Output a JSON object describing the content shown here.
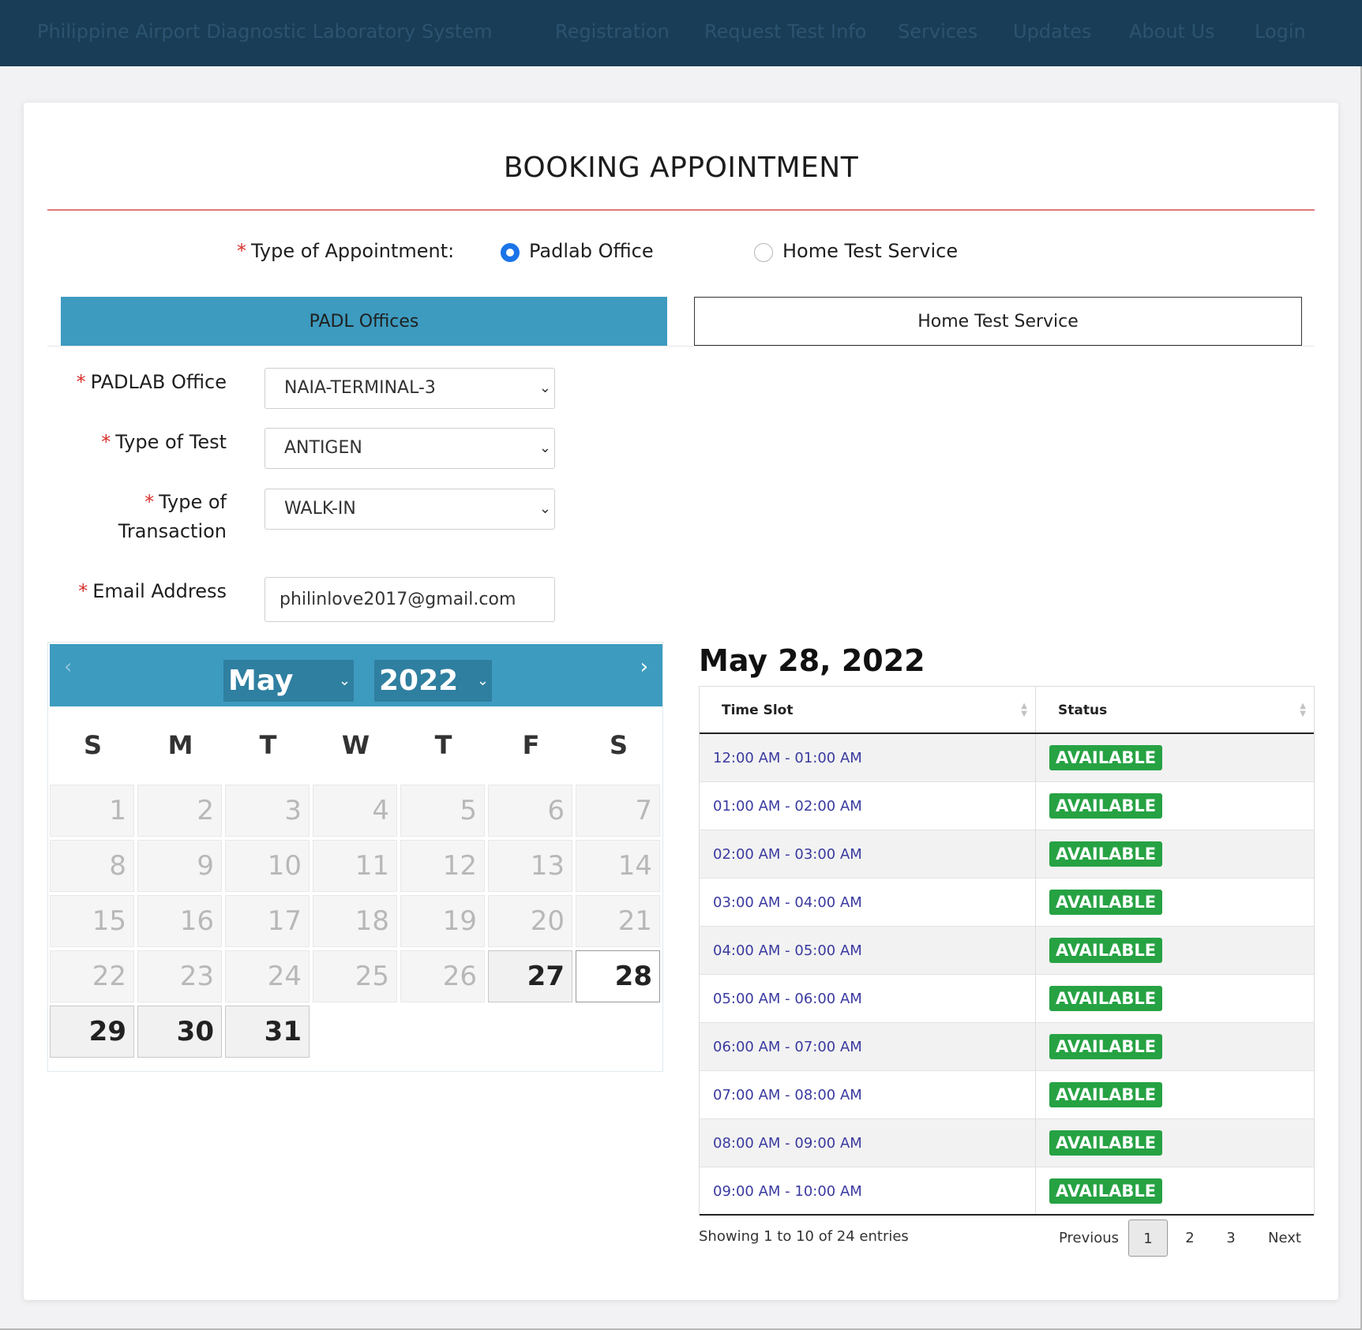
{
  "nav": {
    "brand": "Philippine Airport Diagnostic Laboratory System",
    "links": [
      "Registration",
      "Request Test Info",
      "Services",
      "Updates",
      "About Us",
      "Login"
    ]
  },
  "page_title": "BOOKING APPOINTMENT",
  "appointment": {
    "label": "Type of Appointment:",
    "options": [
      "Padlab Office",
      "Home Test Service"
    ],
    "selected": "Padlab Office"
  },
  "tabs": [
    "PADL Offices",
    "Home Test Service"
  ],
  "form": {
    "office_label": "PADLAB Office",
    "office_value": "NAIA-TERMINAL-3",
    "test_label": "Type of Test",
    "test_value": "ANTIGEN",
    "transaction_label_1": "Type of",
    "transaction_label_2": "Transaction",
    "transaction_value": "WALK-IN",
    "email_label": "Email Address",
    "email_value": "philinlove2017@gmail.com"
  },
  "calendar": {
    "month": "May",
    "year": "2022",
    "weekdays": [
      "S",
      "M",
      "T",
      "W",
      "T",
      "F",
      "S"
    ],
    "days": [
      "1",
      "2",
      "3",
      "4",
      "5",
      "6",
      "7",
      "8",
      "9",
      "10",
      "11",
      "12",
      "13",
      "14",
      "15",
      "16",
      "17",
      "18",
      "19",
      "20",
      "21",
      "22",
      "23",
      "24",
      "25",
      "26",
      "27",
      "28",
      "29",
      "30",
      "31"
    ],
    "first_enabled_day": 27,
    "selected_day": 28
  },
  "schedule": {
    "date_heading": "May 28, 2022",
    "columns": [
      "Time Slot",
      "Status"
    ],
    "rows": [
      {
        "time": "12:00 AM - 01:00 AM",
        "status": "AVAILABLE"
      },
      {
        "time": "01:00 AM - 02:00 AM",
        "status": "AVAILABLE"
      },
      {
        "time": "02:00 AM - 03:00 AM",
        "status": "AVAILABLE"
      },
      {
        "time": "03:00 AM - 04:00 AM",
        "status": "AVAILABLE"
      },
      {
        "time": "04:00 AM - 05:00 AM",
        "status": "AVAILABLE"
      },
      {
        "time": "05:00 AM - 06:00 AM",
        "status": "AVAILABLE"
      },
      {
        "time": "06:00 AM - 07:00 AM",
        "status": "AVAILABLE"
      },
      {
        "time": "07:00 AM - 08:00 AM",
        "status": "AVAILABLE"
      },
      {
        "time": "08:00 AM - 09:00 AM",
        "status": "AVAILABLE"
      },
      {
        "time": "09:00 AM - 10:00 AM",
        "status": "AVAILABLE"
      }
    ],
    "info": "Showing 1 to 10 of 24 entries",
    "pagination": {
      "previous": "Previous",
      "pages": [
        "1",
        "2",
        "3"
      ],
      "current": "1",
      "next": "Next"
    }
  },
  "colors": {
    "navbar": "#193d56",
    "accent": "#3d9bbf",
    "available": "#26a243",
    "required": "#d9302c"
  }
}
